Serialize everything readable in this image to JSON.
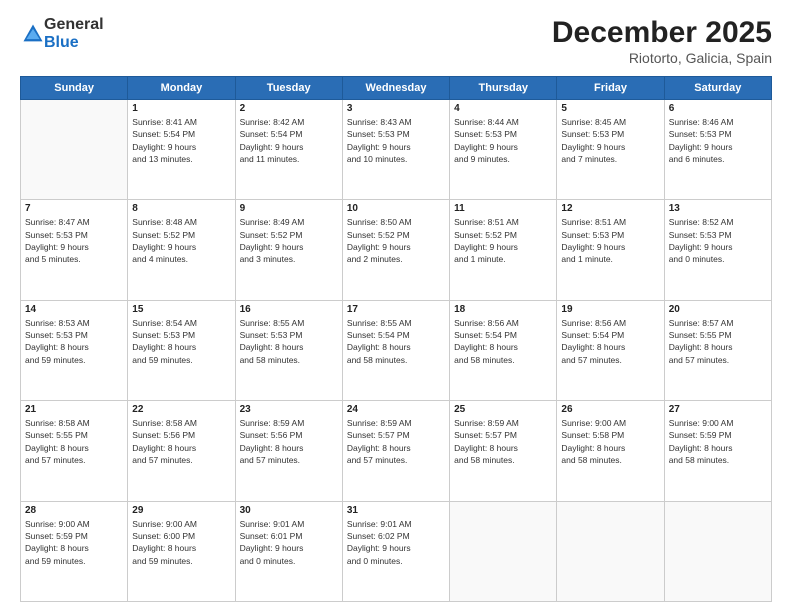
{
  "logo": {
    "general": "General",
    "blue": "Blue"
  },
  "header": {
    "month": "December 2025",
    "location": "Riotorto, Galicia, Spain"
  },
  "weekdays": [
    "Sunday",
    "Monday",
    "Tuesday",
    "Wednesday",
    "Thursday",
    "Friday",
    "Saturday"
  ],
  "weeks": [
    [
      {
        "day": "",
        "detail": ""
      },
      {
        "day": "1",
        "detail": "Sunrise: 8:41 AM\nSunset: 5:54 PM\nDaylight: 9 hours\nand 13 minutes."
      },
      {
        "day": "2",
        "detail": "Sunrise: 8:42 AM\nSunset: 5:54 PM\nDaylight: 9 hours\nand 11 minutes."
      },
      {
        "day": "3",
        "detail": "Sunrise: 8:43 AM\nSunset: 5:53 PM\nDaylight: 9 hours\nand 10 minutes."
      },
      {
        "day": "4",
        "detail": "Sunrise: 8:44 AM\nSunset: 5:53 PM\nDaylight: 9 hours\nand 9 minutes."
      },
      {
        "day": "5",
        "detail": "Sunrise: 8:45 AM\nSunset: 5:53 PM\nDaylight: 9 hours\nand 7 minutes."
      },
      {
        "day": "6",
        "detail": "Sunrise: 8:46 AM\nSunset: 5:53 PM\nDaylight: 9 hours\nand 6 minutes."
      }
    ],
    [
      {
        "day": "7",
        "detail": "Sunrise: 8:47 AM\nSunset: 5:53 PM\nDaylight: 9 hours\nand 5 minutes."
      },
      {
        "day": "8",
        "detail": "Sunrise: 8:48 AM\nSunset: 5:52 PM\nDaylight: 9 hours\nand 4 minutes."
      },
      {
        "day": "9",
        "detail": "Sunrise: 8:49 AM\nSunset: 5:52 PM\nDaylight: 9 hours\nand 3 minutes."
      },
      {
        "day": "10",
        "detail": "Sunrise: 8:50 AM\nSunset: 5:52 PM\nDaylight: 9 hours\nand 2 minutes."
      },
      {
        "day": "11",
        "detail": "Sunrise: 8:51 AM\nSunset: 5:52 PM\nDaylight: 9 hours\nand 1 minute."
      },
      {
        "day": "12",
        "detail": "Sunrise: 8:51 AM\nSunset: 5:53 PM\nDaylight: 9 hours\nand 1 minute."
      },
      {
        "day": "13",
        "detail": "Sunrise: 8:52 AM\nSunset: 5:53 PM\nDaylight: 9 hours\nand 0 minutes."
      }
    ],
    [
      {
        "day": "14",
        "detail": "Sunrise: 8:53 AM\nSunset: 5:53 PM\nDaylight: 8 hours\nand 59 minutes."
      },
      {
        "day": "15",
        "detail": "Sunrise: 8:54 AM\nSunset: 5:53 PM\nDaylight: 8 hours\nand 59 minutes."
      },
      {
        "day": "16",
        "detail": "Sunrise: 8:55 AM\nSunset: 5:53 PM\nDaylight: 8 hours\nand 58 minutes."
      },
      {
        "day": "17",
        "detail": "Sunrise: 8:55 AM\nSunset: 5:54 PM\nDaylight: 8 hours\nand 58 minutes."
      },
      {
        "day": "18",
        "detail": "Sunrise: 8:56 AM\nSunset: 5:54 PM\nDaylight: 8 hours\nand 58 minutes."
      },
      {
        "day": "19",
        "detail": "Sunrise: 8:56 AM\nSunset: 5:54 PM\nDaylight: 8 hours\nand 57 minutes."
      },
      {
        "day": "20",
        "detail": "Sunrise: 8:57 AM\nSunset: 5:55 PM\nDaylight: 8 hours\nand 57 minutes."
      }
    ],
    [
      {
        "day": "21",
        "detail": "Sunrise: 8:58 AM\nSunset: 5:55 PM\nDaylight: 8 hours\nand 57 minutes."
      },
      {
        "day": "22",
        "detail": "Sunrise: 8:58 AM\nSunset: 5:56 PM\nDaylight: 8 hours\nand 57 minutes."
      },
      {
        "day": "23",
        "detail": "Sunrise: 8:59 AM\nSunset: 5:56 PM\nDaylight: 8 hours\nand 57 minutes."
      },
      {
        "day": "24",
        "detail": "Sunrise: 8:59 AM\nSunset: 5:57 PM\nDaylight: 8 hours\nand 57 minutes."
      },
      {
        "day": "25",
        "detail": "Sunrise: 8:59 AM\nSunset: 5:57 PM\nDaylight: 8 hours\nand 58 minutes."
      },
      {
        "day": "26",
        "detail": "Sunrise: 9:00 AM\nSunset: 5:58 PM\nDaylight: 8 hours\nand 58 minutes."
      },
      {
        "day": "27",
        "detail": "Sunrise: 9:00 AM\nSunset: 5:59 PM\nDaylight: 8 hours\nand 58 minutes."
      }
    ],
    [
      {
        "day": "28",
        "detail": "Sunrise: 9:00 AM\nSunset: 5:59 PM\nDaylight: 8 hours\nand 59 minutes."
      },
      {
        "day": "29",
        "detail": "Sunrise: 9:00 AM\nSunset: 6:00 PM\nDaylight: 8 hours\nand 59 minutes."
      },
      {
        "day": "30",
        "detail": "Sunrise: 9:01 AM\nSunset: 6:01 PM\nDaylight: 9 hours\nand 0 minutes."
      },
      {
        "day": "31",
        "detail": "Sunrise: 9:01 AM\nSunset: 6:02 PM\nDaylight: 9 hours\nand 0 minutes."
      },
      {
        "day": "",
        "detail": ""
      },
      {
        "day": "",
        "detail": ""
      },
      {
        "day": "",
        "detail": ""
      }
    ]
  ]
}
